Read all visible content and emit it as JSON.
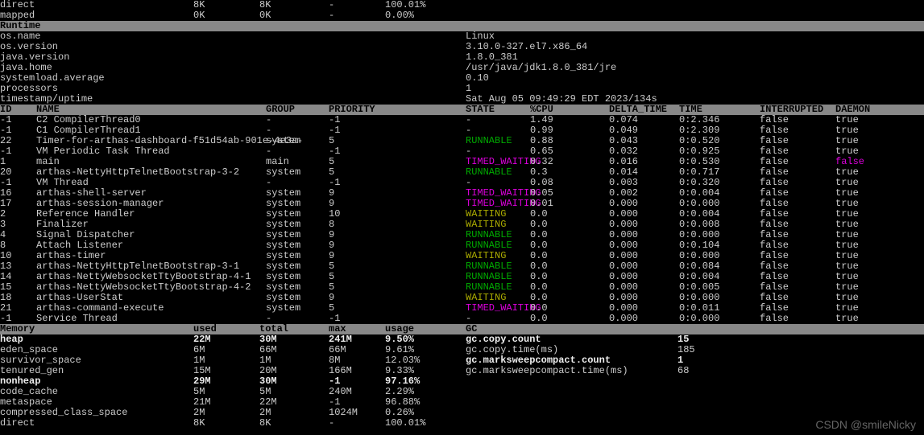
{
  "top": [
    {
      "name": "direct",
      "used": "8K",
      "total": "8K",
      "max": "-",
      "usage": "100.01%"
    },
    {
      "name": "mapped",
      "used": "0K",
      "total": "0K",
      "max": "-",
      "usage": "0.00%"
    }
  ],
  "sections": {
    "runtime": "Runtime",
    "memory": "Memory",
    "gc": "GC"
  },
  "runtime": [
    {
      "k": "os.name",
      "v": "Linux"
    },
    {
      "k": "os.version",
      "v": "3.10.0-327.el7.x86_64"
    },
    {
      "k": "java.version",
      "v": "1.8.0_381"
    },
    {
      "k": "java.home",
      "v": "/usr/java/jdk1.8.0_381/jre"
    },
    {
      "k": "systemload.average",
      "v": "0.10"
    },
    {
      "k": "processors",
      "v": "1"
    },
    {
      "k": "timestamp/uptime",
      "v": "Sat Aug 05 09:49:29 EDT 2023/134s"
    }
  ],
  "thread_headers": {
    "id": "ID",
    "name": "NAME",
    "group": "GROUP",
    "pri": "PRIORITY",
    "state": "STATE",
    "cpu": "%CPU",
    "dt": "DELTA_TIME",
    "time": "TIME",
    "intr": "INTERRUPTED",
    "dae": "DAEMON"
  },
  "threads": [
    {
      "id": "-1",
      "name": "C2 CompilerThread0",
      "group": "-",
      "pri": "-1",
      "state": "-",
      "stateClass": "",
      "cpu": "1.49",
      "dt": "0.074",
      "time": "0:2.346",
      "intr": "false",
      "dae": "true",
      "daeClass": ""
    },
    {
      "id": "-1",
      "name": "C1 CompilerThread1",
      "group": "-",
      "pri": "-1",
      "state": "-",
      "stateClass": "",
      "cpu": "0.99",
      "dt": "0.049",
      "time": "0:2.309",
      "intr": "false",
      "dae": "true",
      "daeClass": ""
    },
    {
      "id": "22",
      "name": "Timer-for-arthas-dashboard-f51d54ab-901e-4e3a-",
      "group": "system",
      "pri": "5",
      "state": "RUNNABLE",
      "stateClass": "green",
      "cpu": "0.88",
      "dt": "0.043",
      "time": "0:0.520",
      "intr": "false",
      "dae": "true",
      "daeClass": ""
    },
    {
      "id": "-1",
      "name": "VM Periodic Task Thread",
      "group": "-",
      "pri": "-1",
      "state": "-",
      "stateClass": "",
      "cpu": "0.65",
      "dt": "0.032",
      "time": "0:0.925",
      "intr": "false",
      "dae": "true",
      "daeClass": ""
    },
    {
      "id": "1",
      "name": "main",
      "group": "main",
      "pri": "5",
      "state": "TIMED_WAITING",
      "stateClass": "magenta",
      "cpu": "0.32",
      "dt": "0.016",
      "time": "0:0.530",
      "intr": "false",
      "dae": "false",
      "daeClass": "magenta"
    },
    {
      "id": "20",
      "name": "arthas-NettyHttpTelnetBootstrap-3-2",
      "group": "system",
      "pri": "5",
      "state": "RUNNABLE",
      "stateClass": "green",
      "cpu": "0.3",
      "dt": "0.014",
      "time": "0:0.717",
      "intr": "false",
      "dae": "true",
      "daeClass": ""
    },
    {
      "id": "-1",
      "name": "VM Thread",
      "group": "-",
      "pri": "-1",
      "state": "-",
      "stateClass": "",
      "cpu": "0.08",
      "dt": "0.003",
      "time": "0:0.320",
      "intr": "false",
      "dae": "true",
      "daeClass": ""
    },
    {
      "id": "16",
      "name": "arthas-shell-server",
      "group": "system",
      "pri": "9",
      "state": "TIMED_WAITING",
      "stateClass": "magenta",
      "cpu": "0.05",
      "dt": "0.002",
      "time": "0:0.004",
      "intr": "false",
      "dae": "true",
      "daeClass": ""
    },
    {
      "id": "17",
      "name": "arthas-session-manager",
      "group": "system",
      "pri": "9",
      "state": "TIMED_WAITING",
      "stateClass": "magenta",
      "cpu": "0.01",
      "dt": "0.000",
      "time": "0:0.000",
      "intr": "false",
      "dae": "true",
      "daeClass": ""
    },
    {
      "id": "2",
      "name": "Reference Handler",
      "group": "system",
      "pri": "10",
      "state": "WAITING",
      "stateClass": "olive",
      "cpu": "0.0",
      "dt": "0.000",
      "time": "0:0.004",
      "intr": "false",
      "dae": "true",
      "daeClass": ""
    },
    {
      "id": "3",
      "name": "Finalizer",
      "group": "system",
      "pri": "8",
      "state": "WAITING",
      "stateClass": "olive",
      "cpu": "0.0",
      "dt": "0.000",
      "time": "0:0.008",
      "intr": "false",
      "dae": "true",
      "daeClass": ""
    },
    {
      "id": "4",
      "name": "Signal Dispatcher",
      "group": "system",
      "pri": "9",
      "state": "RUNNABLE",
      "stateClass": "green",
      "cpu": "0.0",
      "dt": "0.000",
      "time": "0:0.000",
      "intr": "false",
      "dae": "true",
      "daeClass": ""
    },
    {
      "id": "8",
      "name": "Attach Listener",
      "group": "system",
      "pri": "9",
      "state": "RUNNABLE",
      "stateClass": "green",
      "cpu": "0.0",
      "dt": "0.000",
      "time": "0:0.104",
      "intr": "false",
      "dae": "true",
      "daeClass": ""
    },
    {
      "id": "10",
      "name": "arthas-timer",
      "group": "system",
      "pri": "9",
      "state": "WAITING",
      "stateClass": "olive",
      "cpu": "0.0",
      "dt": "0.000",
      "time": "0:0.000",
      "intr": "false",
      "dae": "true",
      "daeClass": ""
    },
    {
      "id": "13",
      "name": "arthas-NettyHttpTelnetBootstrap-3-1",
      "group": "system",
      "pri": "5",
      "state": "RUNNABLE",
      "stateClass": "green",
      "cpu": "0.0",
      "dt": "0.000",
      "time": "0:0.084",
      "intr": "false",
      "dae": "true",
      "daeClass": ""
    },
    {
      "id": "14",
      "name": "arthas-NettyWebsocketTtyBootstrap-4-1",
      "group": "system",
      "pri": "5",
      "state": "RUNNABLE",
      "stateClass": "green",
      "cpu": "0.0",
      "dt": "0.000",
      "time": "0:0.004",
      "intr": "false",
      "dae": "true",
      "daeClass": ""
    },
    {
      "id": "15",
      "name": "arthas-NettyWebsocketTtyBootstrap-4-2",
      "group": "system",
      "pri": "5",
      "state": "RUNNABLE",
      "stateClass": "green",
      "cpu": "0.0",
      "dt": "0.000",
      "time": "0:0.005",
      "intr": "false",
      "dae": "true",
      "daeClass": ""
    },
    {
      "id": "18",
      "name": "arthas-UserStat",
      "group": "system",
      "pri": "9",
      "state": "WAITING",
      "stateClass": "olive",
      "cpu": "0.0",
      "dt": "0.000",
      "time": "0:0.000",
      "intr": "false",
      "dae": "true",
      "daeClass": ""
    },
    {
      "id": "21",
      "name": "arthas-command-execute",
      "group": "system",
      "pri": "5",
      "state": "TIMED_WAITING",
      "stateClass": "magenta",
      "cpu": "0.0",
      "dt": "0.000",
      "time": "0:0.011",
      "intr": "false",
      "dae": "true",
      "daeClass": ""
    },
    {
      "id": "-1",
      "name": "Service Thread",
      "group": "-",
      "pri": "-1",
      "state": "-",
      "stateClass": "",
      "cpu": "0.0",
      "dt": "0.000",
      "time": "0:0.000",
      "intr": "false",
      "dae": "true",
      "daeClass": ""
    }
  ],
  "mem_headers": {
    "name": "Memory",
    "used": "used",
    "total": "total",
    "max": "max",
    "usage": "usage",
    "gc": "GC"
  },
  "memory": [
    {
      "name": "heap",
      "nb": true,
      "used": "22M",
      "total": "30M",
      "max": "241M",
      "usage": "9.50%",
      "gcName": "gc.copy.count",
      "gcNameBold": true,
      "gcVal": "15"
    },
    {
      "name": "eden_space",
      "nb": false,
      "used": "6M",
      "total": "66M",
      "max": "66M",
      "usage": "9.61%",
      "gcName": "gc.copy.time(ms)",
      "gcNameBold": false,
      "gcVal": "185"
    },
    {
      "name": "survivor_space",
      "nb": false,
      "used": "1M",
      "total": "1M",
      "max": "8M",
      "usage": "12.03%",
      "gcName": "gc.marksweepcompact.count",
      "gcNameBold": true,
      "gcVal": "1"
    },
    {
      "name": "tenured_gen",
      "nb": false,
      "used": "15M",
      "total": "20M",
      "max": "166M",
      "usage": "9.33%",
      "gcName": "gc.marksweepcompact.time(ms)",
      "gcNameBold": false,
      "gcVal": "68"
    },
    {
      "name": "nonheap",
      "nb": true,
      "used": "29M",
      "total": "30M",
      "max": "-1",
      "usage": "97.16%",
      "gcName": "",
      "gcNameBold": false,
      "gcVal": ""
    },
    {
      "name": "code_cache",
      "nb": false,
      "used": "5M",
      "total": "5M",
      "max": "240M",
      "usage": "2.29%",
      "gcName": "",
      "gcNameBold": false,
      "gcVal": ""
    },
    {
      "name": "metaspace",
      "nb": false,
      "used": "21M",
      "total": "22M",
      "max": "-1",
      "usage": "96.88%",
      "gcName": "",
      "gcNameBold": false,
      "gcVal": ""
    },
    {
      "name": "compressed_class_space",
      "nb": false,
      "used": "2M",
      "total": "2M",
      "max": "1024M",
      "usage": "0.26%",
      "gcName": "",
      "gcNameBold": false,
      "gcVal": ""
    },
    {
      "name": "direct",
      "nb": false,
      "used": "8K",
      "total": "8K",
      "max": "-",
      "usage": "100.01%",
      "gcName": "",
      "gcNameBold": false,
      "gcVal": ""
    }
  ],
  "watermark": "CSDN @smileNicky"
}
